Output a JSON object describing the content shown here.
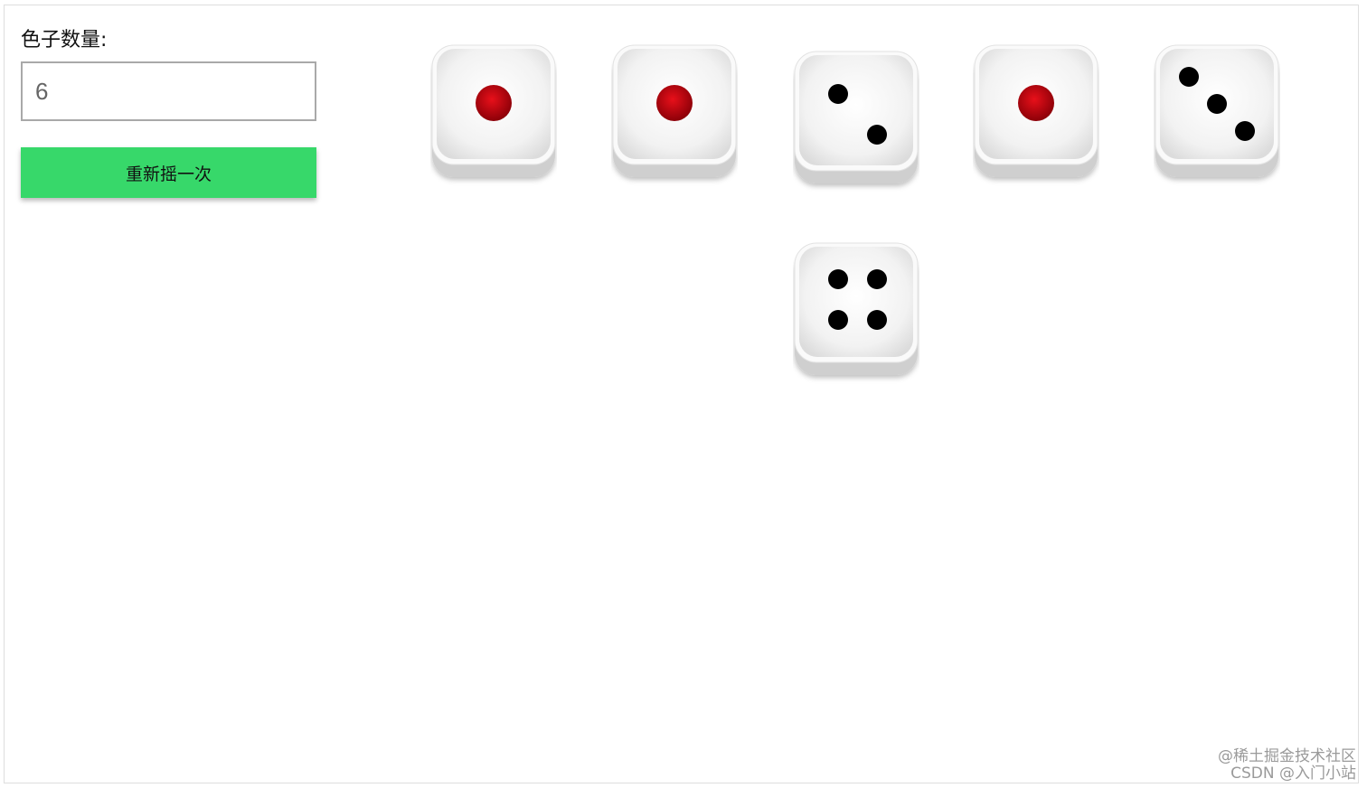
{
  "controls": {
    "count_label": "色子数量:",
    "count_value": "6",
    "roll_button_label": "重新摇一次"
  },
  "dice": [
    {
      "value": 1
    },
    {
      "value": 1
    },
    {
      "value": 2
    },
    {
      "value": 1
    },
    {
      "value": 3
    },
    {
      "value": 4
    }
  ],
  "colors": {
    "button_green": "#37d86a",
    "pip_red": "#c8000a",
    "pip_black": "#000000"
  },
  "watermark": {
    "line1": "@稀土掘金技术社区",
    "line2": "CSDN @入门小站"
  }
}
